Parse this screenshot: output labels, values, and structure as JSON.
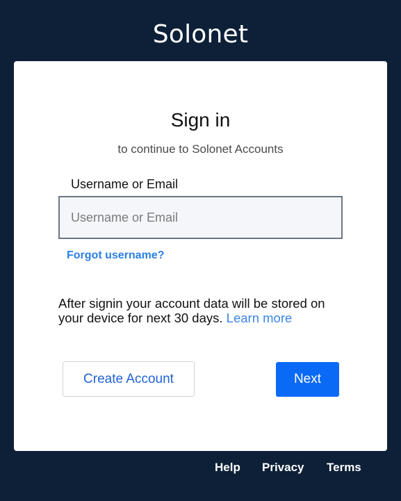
{
  "brand": {
    "name": "Solonet"
  },
  "signin": {
    "title": "Sign in",
    "subtitle": "to continue to Solonet Accounts",
    "field_label": "Username or Email",
    "input_placeholder": "Username or Email",
    "input_value": "",
    "forgot_link": "Forgot username?",
    "info_text": "After signin your account data will be stored on your device for next 30 days.",
    "learn_more": "Learn more",
    "create_account_label": "Create Account",
    "next_label": "Next"
  },
  "footer": {
    "help": "Help",
    "privacy": "Privacy",
    "terms": "Terms"
  },
  "colors": {
    "background": "#0d2038",
    "card": "#ffffff",
    "link": "#2a7fe6",
    "primary_button": "#0a6af5"
  }
}
